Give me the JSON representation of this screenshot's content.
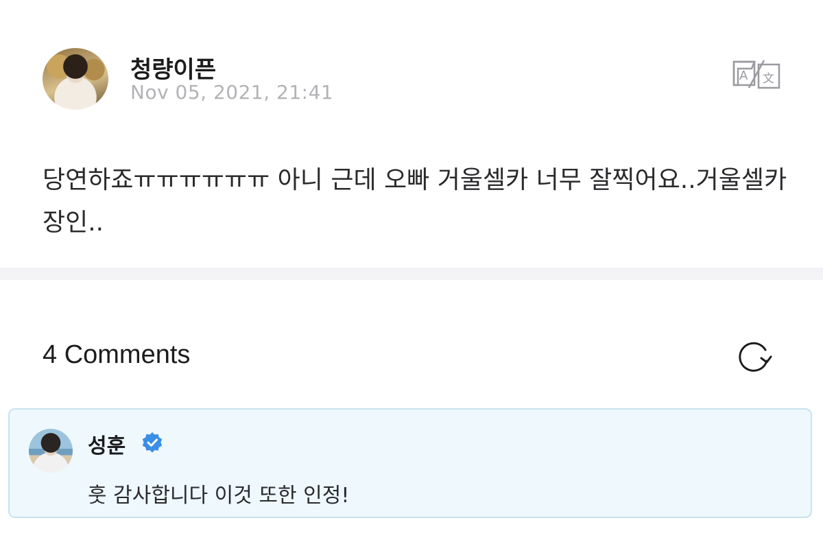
{
  "post": {
    "author": "청량이픈",
    "date": "Nov 05, 2021, 21:41",
    "body": "당연하죠ㅠㅠㅠㅠㅠㅠ 아니 근데 오빠 거울셀카 너무 잘찍어요..거울셀카 장인..",
    "translate_icon": "translate-icon"
  },
  "comments": {
    "count_label": "4 Comments",
    "refresh_icon": "refresh-icon",
    "items": [
      {
        "author": "성훈",
        "verified": true,
        "text": "훗 감사합니다 이것 또한 인정!"
      }
    ]
  },
  "colors": {
    "date_gray": "#b2b2b7",
    "verified_blue": "#3a8ee6",
    "comment_bg": "#eef8fd",
    "comment_border": "#c7e3ee",
    "divider": "#f3f3f6"
  }
}
